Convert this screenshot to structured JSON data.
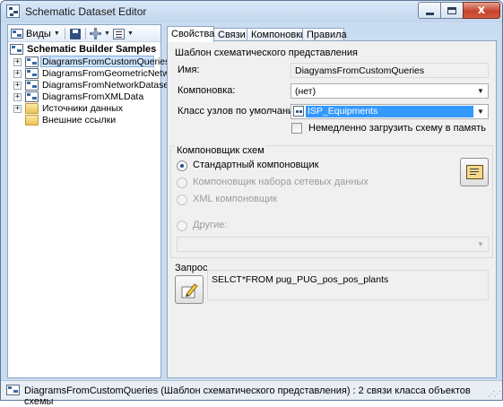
{
  "window": {
    "title": "Schematic Dataset Editor",
    "close_label": "x"
  },
  "toolbar": {
    "views_label": "Виды",
    "views_icon": "views-icon",
    "save_icon": "save-icon",
    "layout_icon": "layout-icon",
    "list_icon": "list-icon"
  },
  "tree": {
    "root": "Schematic Builder Samples",
    "items": [
      {
        "label": "DiagramsFromCustomQueries",
        "type": "diagram",
        "selected": true
      },
      {
        "label": "DiagramsFromGeometricNetwork",
        "type": "diagram",
        "selected": false
      },
      {
        "label": "DiagramsFromNetworkDataset",
        "type": "diagram",
        "selected": false
      },
      {
        "label": "DiagramsFromXMLData",
        "type": "diagram",
        "selected": false
      },
      {
        "label": "Источники данных",
        "type": "folder",
        "selected": false
      },
      {
        "label": "Внешние ссылки",
        "type": "folder",
        "selected": false
      }
    ],
    "expander_symbol": "+"
  },
  "tabs": [
    {
      "label": "Свойства",
      "active": true
    },
    {
      "label": "Связи",
      "active": false
    },
    {
      "label": "Компоновки",
      "active": false
    },
    {
      "label": "Правила",
      "active": false
    }
  ],
  "template_group": {
    "title": "Шаблон схематического представления",
    "name_label": "Имя:",
    "name_value": "DiagyamsFromCustomQueries",
    "layout_label": "Компоновка:",
    "layout_value": "(нет)",
    "class_label": "Класс узлов по умолчанию:",
    "class_value": "ISP_Equipments",
    "load_checkbox_label": "Немедленно загрузить схему в память"
  },
  "layouter_group": {
    "title": "Компоновщик схем",
    "options": [
      {
        "label": "Стандартный компоновщик",
        "checked": true,
        "enabled": true
      },
      {
        "label": "Компоновщик набора сетевых данных",
        "checked": false,
        "enabled": false
      },
      {
        "label": "XML  компоновщик",
        "checked": false,
        "enabled": false
      },
      {
        "label": "Другие:",
        "checked": false,
        "enabled": false
      }
    ],
    "other_value": ""
  },
  "query_group": {
    "title": "Запрос",
    "query_text": "SELCT*FROM pug_PUG_pos_pos_plants"
  },
  "statusbar": {
    "text": "DiagramsFromCustomQueries (Шаблон схематического представления) : 2 связи класса объектов схемы"
  }
}
